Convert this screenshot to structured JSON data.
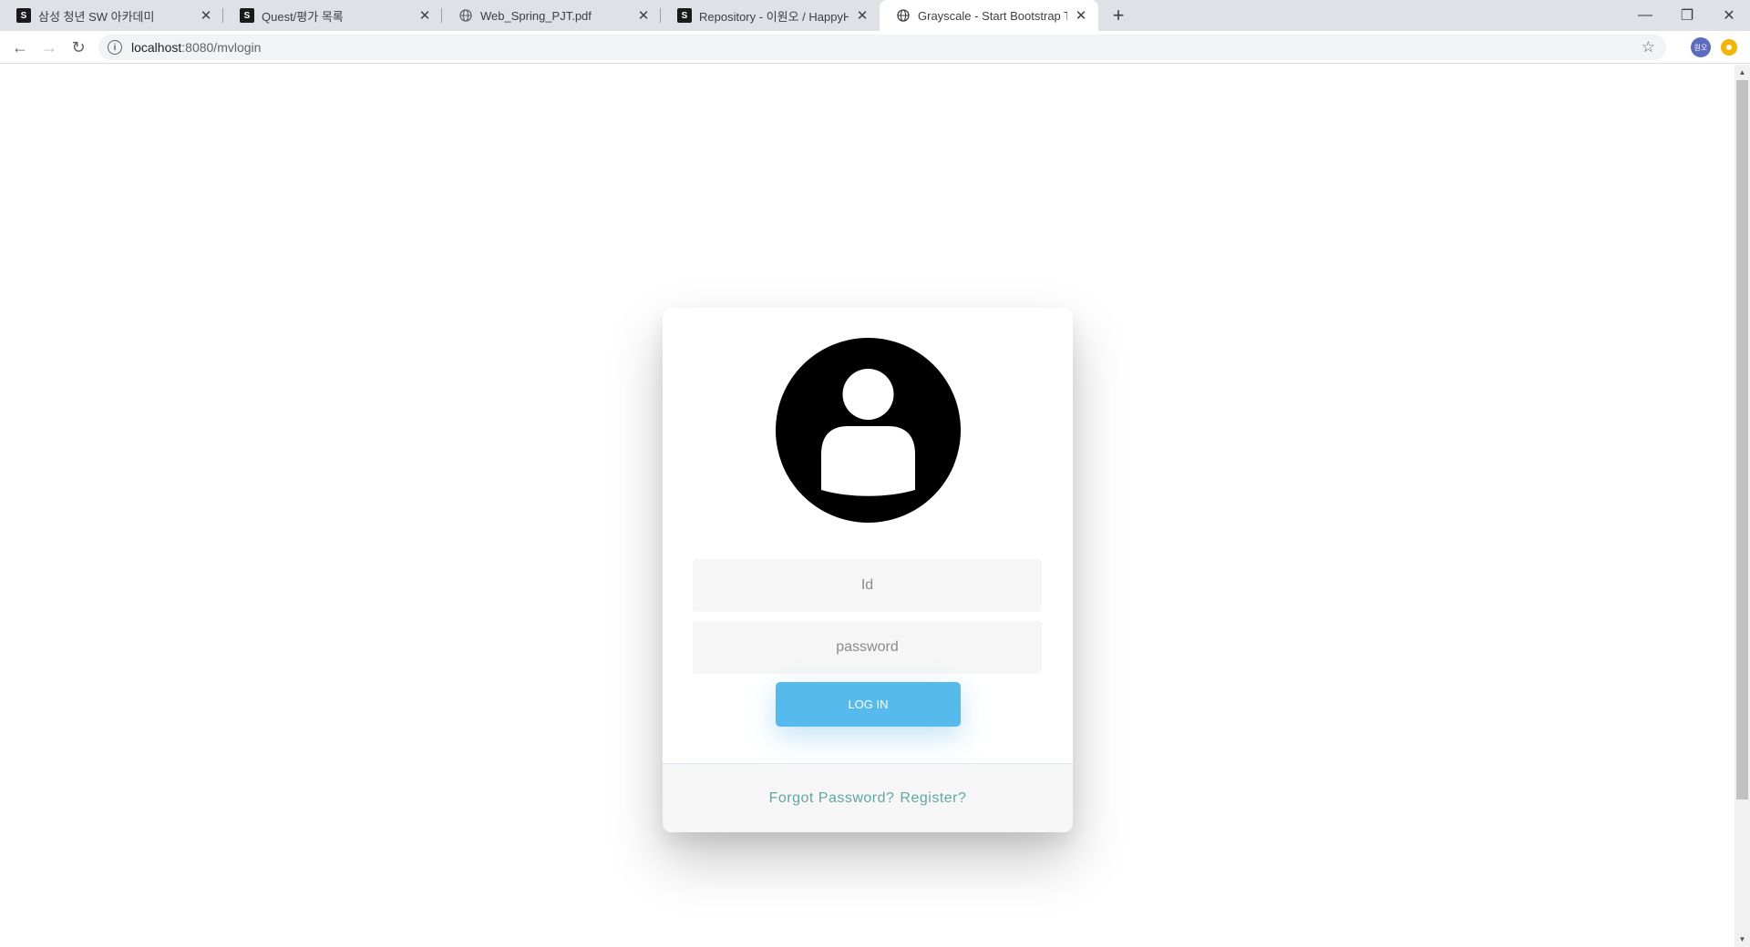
{
  "browser": {
    "tabs": [
      {
        "title": "삼성 청년 SW 아카데미",
        "favicon": "samsung-icon",
        "active": false
      },
      {
        "title": "Quest/평가 목록",
        "favicon": "samsung-icon",
        "active": false
      },
      {
        "title": "Web_Spring_PJT.pdf",
        "favicon": "globe-icon",
        "active": false
      },
      {
        "title": "Repository - 이원오 / HappyHou",
        "favicon": "samsung-icon",
        "active": false
      },
      {
        "title": "Grayscale - Start Bootstrap The",
        "favicon": "globe-icon",
        "active": true
      }
    ],
    "new_tab_label": "+",
    "address": {
      "host": "localhost",
      "path": ":8080/mvlogin"
    },
    "profile_initials": "원오"
  },
  "login": {
    "id_placeholder": "Id",
    "password_placeholder": "password",
    "login_label": "LOG IN",
    "forgot_label": "Forgot Password?",
    "register_label": "Register?"
  },
  "colors": {
    "button": "#56baed",
    "footer_link": "#5fa8a0",
    "input_bg": "#f6f6f6"
  }
}
